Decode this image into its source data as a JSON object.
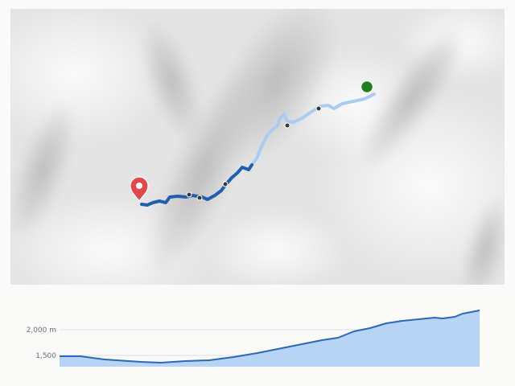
{
  "map": {
    "colors": {
      "background": "#e6e6e6",
      "track_light": "#a9cdf2",
      "track_dark": "#1f5fae",
      "waypoint": "#3a3a3a",
      "start_marker": "#1e7f1e",
      "end_marker": "#e0484b"
    },
    "markers": [
      {
        "name": "start-marker",
        "icon": "green-dot"
      },
      {
        "name": "end-marker",
        "icon": "red-pin-icon"
      }
    ]
  },
  "elevation": {
    "y_labels": [
      "2,000 m",
      "1,500"
    ],
    "colors": {
      "fill": "#b8d4f5",
      "line": "#2d67b9",
      "grid": "#dde0e6"
    }
  }
}
